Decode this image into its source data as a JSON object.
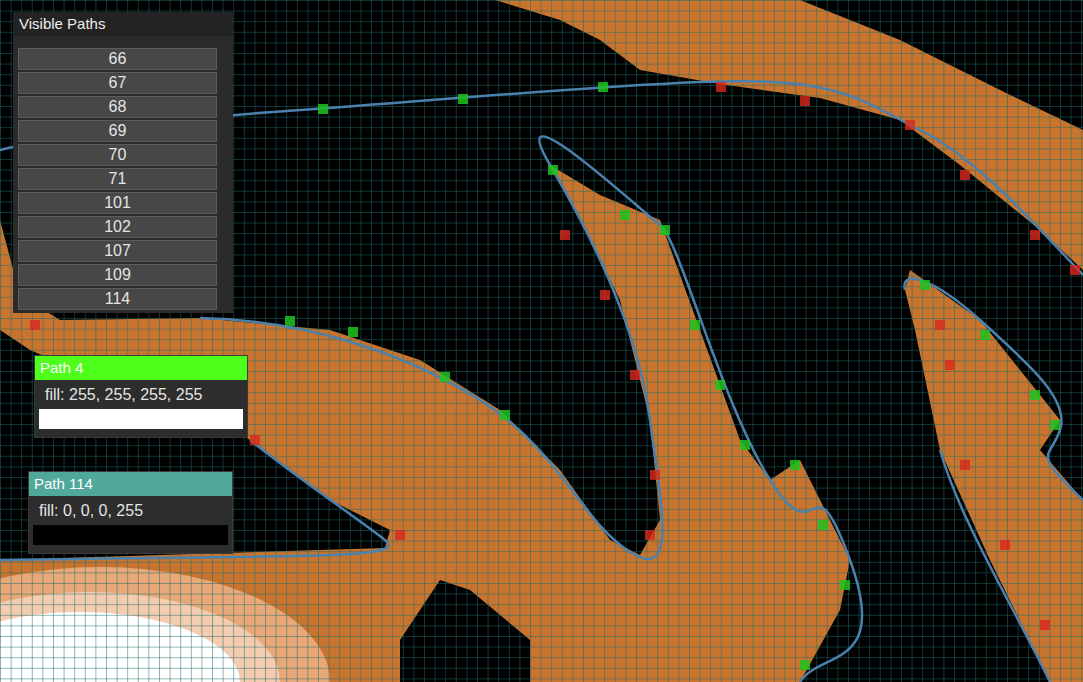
{
  "visible_paths": {
    "title": "Visible Paths",
    "items": [
      "66",
      "67",
      "68",
      "69",
      "70",
      "71",
      "101",
      "102",
      "107",
      "109",
      "114"
    ]
  },
  "path_cards": [
    {
      "title": "Path 4",
      "fill": "fill: 255, 255, 255, 255",
      "color": "#4dff1b"
    },
    {
      "title": "Path 114",
      "fill": "fill: 0, 0, 0, 255",
      "color": "#4fa898"
    }
  ]
}
